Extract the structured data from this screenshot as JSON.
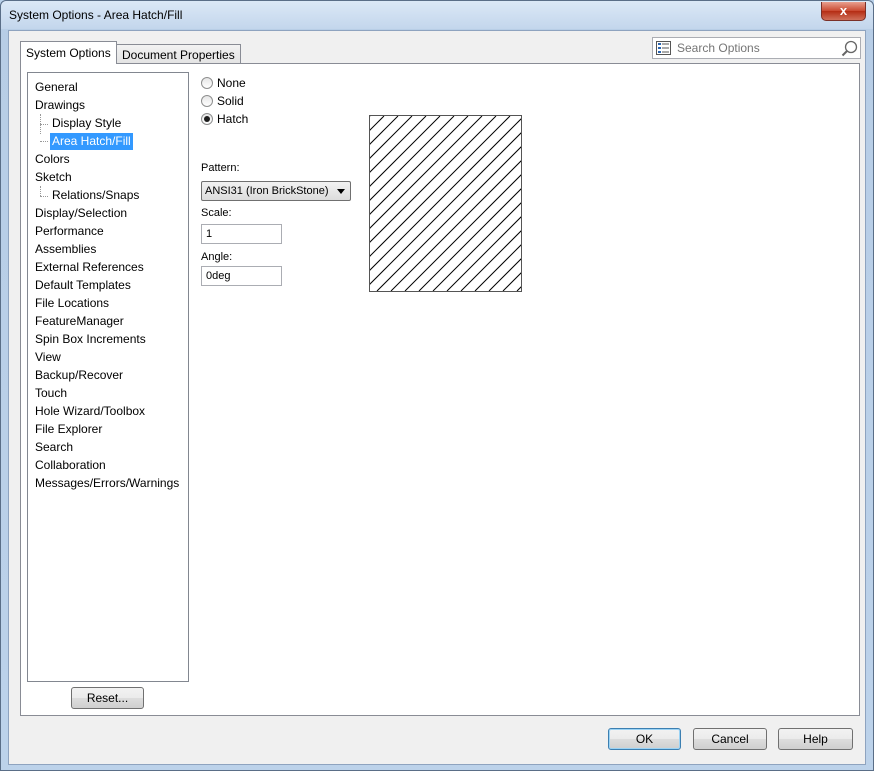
{
  "window": {
    "title": "System Options - Area Hatch/Fill",
    "close_label": "x"
  },
  "tabs": [
    {
      "label": "System Options"
    },
    {
      "label": "Document Properties"
    }
  ],
  "search": {
    "placeholder": "Search Options"
  },
  "tree": {
    "items": [
      {
        "label": "General"
      },
      {
        "label": "Drawings"
      },
      {
        "label": "Display Style"
      },
      {
        "label": "Area Hatch/Fill"
      },
      {
        "label": "Colors"
      },
      {
        "label": "Sketch"
      },
      {
        "label": "Relations/Snaps"
      },
      {
        "label": "Display/Selection"
      },
      {
        "label": "Performance"
      },
      {
        "label": "Assemblies"
      },
      {
        "label": "External References"
      },
      {
        "label": "Default Templates"
      },
      {
        "label": "File Locations"
      },
      {
        "label": "FeatureManager"
      },
      {
        "label": "Spin Box Increments"
      },
      {
        "label": "View"
      },
      {
        "label": "Backup/Recover"
      },
      {
        "label": "Touch"
      },
      {
        "label": "Hole Wizard/Toolbox"
      },
      {
        "label": "File Explorer"
      },
      {
        "label": "Search"
      },
      {
        "label": "Collaboration"
      },
      {
        "label": "Messages/Errors/Warnings"
      }
    ],
    "selected": "Area Hatch/Fill"
  },
  "reset_label": "Reset...",
  "fill_options": {
    "none_label": "None",
    "solid_label": "Solid",
    "hatch_label": "Hatch",
    "selected": "Hatch"
  },
  "pattern": {
    "label": "Pattern:",
    "value": "ANSI31 (Iron BrickStone)"
  },
  "scale": {
    "label": "Scale:",
    "value": "1"
  },
  "angle": {
    "label": "Angle:",
    "value": "0deg"
  },
  "buttons": {
    "ok": "OK",
    "cancel": "Cancel",
    "help": "Help"
  }
}
